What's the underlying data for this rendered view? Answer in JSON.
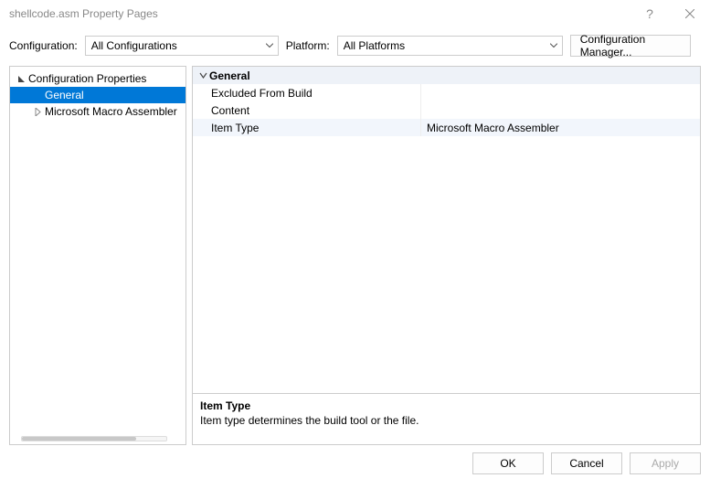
{
  "title": "shellcode.asm Property Pages",
  "toolbar": {
    "config_label": "Configuration:",
    "config_value": "All Configurations",
    "platform_label": "Platform:",
    "platform_value": "All Platforms",
    "config_manager": "Configuration Manager..."
  },
  "tree": {
    "root": "Configuration Properties",
    "items": [
      "General",
      "Microsoft Macro Assembler"
    ],
    "selected_index": 0
  },
  "propgrid": {
    "category": "General",
    "rows": [
      {
        "name": "Excluded From Build",
        "value": ""
      },
      {
        "name": "Content",
        "value": ""
      },
      {
        "name": "Item Type",
        "value": "Microsoft Macro Assembler"
      }
    ],
    "selected_row": 2
  },
  "description": {
    "title": "Item Type",
    "text": "Item type determines the build tool or the file."
  },
  "buttons": {
    "ok": "OK",
    "cancel": "Cancel",
    "apply": "Apply"
  }
}
